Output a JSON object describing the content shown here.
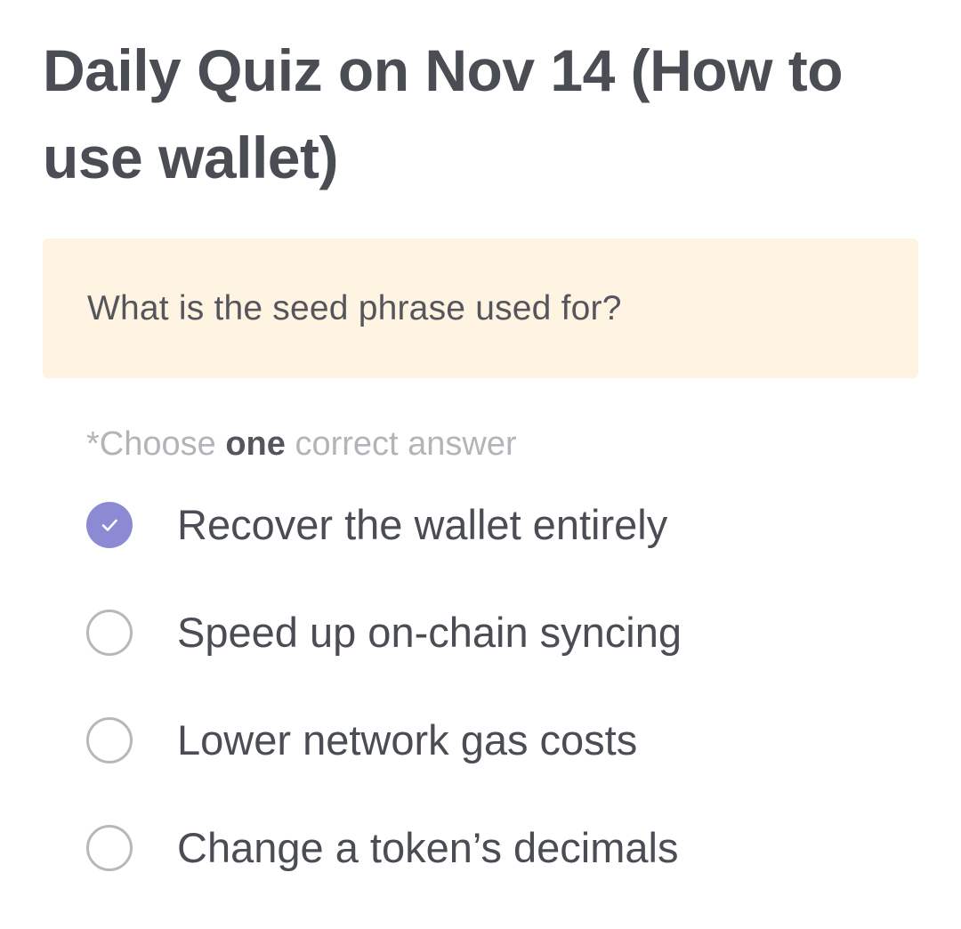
{
  "quiz": {
    "title": "Daily Quiz on Nov 14 (How to use wallet)",
    "question": "What is the seed phrase used for?",
    "instruction": {
      "prefix": "*Choose ",
      "emphasis": "one",
      "suffix": " correct answer"
    },
    "options": [
      {
        "label": "Recover the wallet entirely",
        "selected": true
      },
      {
        "label": "Speed up on-chain syncing",
        "selected": false
      },
      {
        "label": "Lower network gas costs",
        "selected": false
      },
      {
        "label": "Change a token’s decimals",
        "selected": false
      }
    ]
  },
  "colors": {
    "accent": "#8d8ad4",
    "question_background": "#fff3e2",
    "title_text": "#4b4d55",
    "muted_text": "#b3b4b7",
    "radio_border": "#b8b8bc"
  },
  "icons": {
    "selected": "check-icon"
  }
}
